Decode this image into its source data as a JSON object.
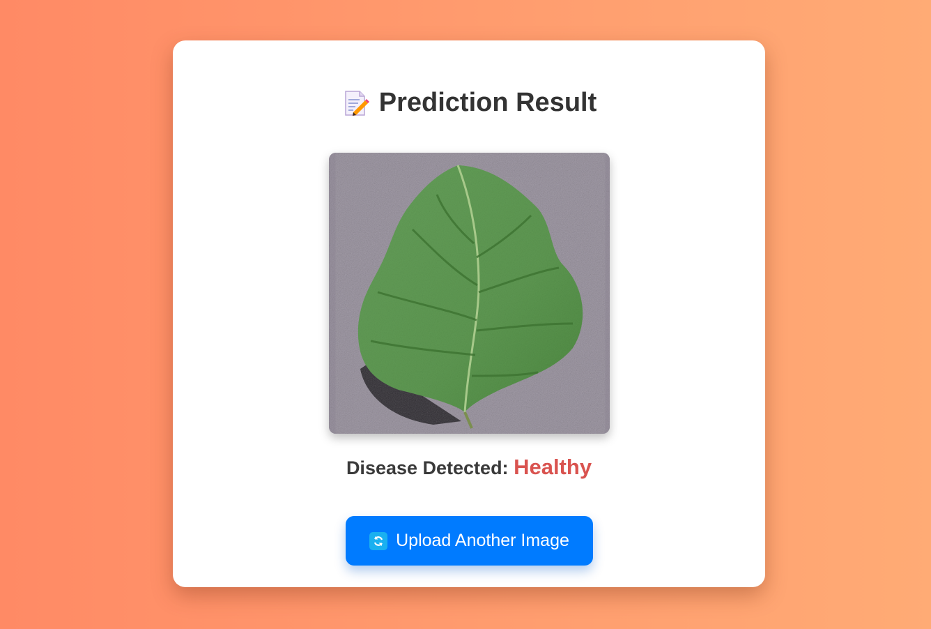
{
  "card": {
    "title": "Prediction Result",
    "title_icon": "memo-icon",
    "image_alt": "leaf-image",
    "result_label": "Disease Detected:",
    "result_value": "Healthy",
    "button_label": "Upload Another Image",
    "button_icon": "refresh-icon"
  },
  "colors": {
    "result_value": "#d9534f",
    "button": "#007bff",
    "background_start": "#ff8a65",
    "background_end": "#ffab75"
  }
}
